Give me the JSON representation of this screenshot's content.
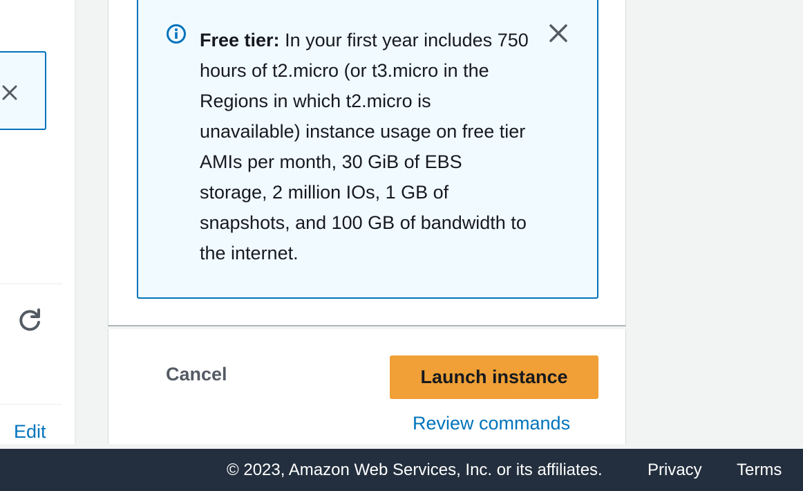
{
  "left_panel": {
    "edit_label": "Edit"
  },
  "free_tier": {
    "heading": "Free tier:",
    "body": "In your first year includes 750 hours of t2.micro (or t3.micro in the Regions in which t2.micro is unavailable) instance usage on free tier AMIs per month, 30 GiB of EBS storage, 2 million IOs, 1 GB of snapshots, and 100 GB of bandwidth to the internet."
  },
  "actions": {
    "cancel_label": "Cancel",
    "launch_label": "Launch instance",
    "review_label": "Review commands"
  },
  "footer": {
    "copyright": "© 2023, Amazon Web Services, Inc. or its affiliates.",
    "privacy": "Privacy",
    "terms": "Terms"
  },
  "colors": {
    "link": "#0073bb",
    "primary_button": "#f0a036",
    "info_background": "#f1faff",
    "footer_background": "#232f3e"
  },
  "icons": [
    "close-icon",
    "refresh-icon",
    "info-icon"
  ]
}
